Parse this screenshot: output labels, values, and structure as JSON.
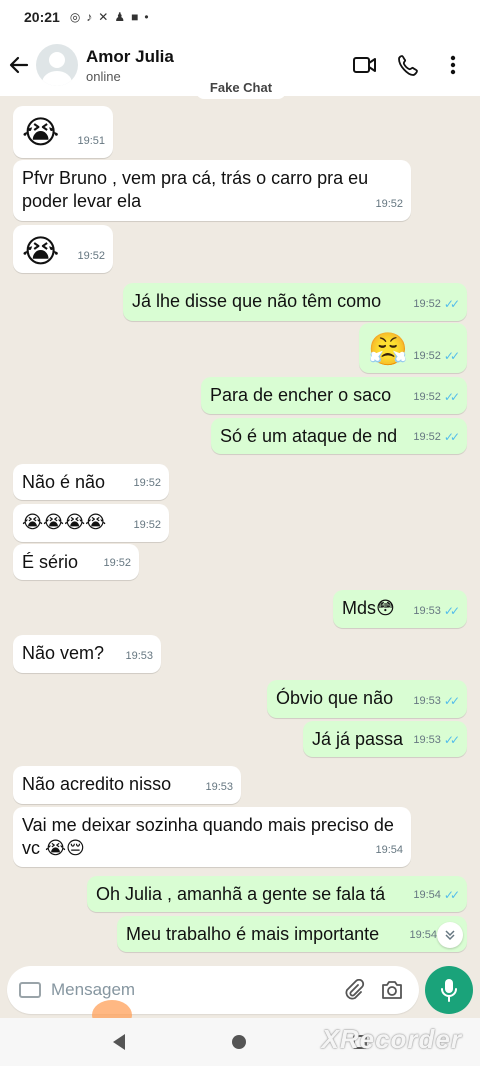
{
  "status_bar": {
    "time": "20:21",
    "icons": [
      "whatsapp-icon",
      "tiktok-icon",
      "capcut-icon",
      "notification-icon",
      "video-icon",
      "dot"
    ]
  },
  "header": {
    "name": "Amor Julia",
    "status": "online"
  },
  "watermark_top": "Fake Chat",
  "messages": [
    {
      "dir": "in",
      "text": "😭",
      "time": "19:51",
      "kind": "emoji"
    },
    {
      "dir": "in",
      "text": "Pfvr Bruno , vem pra cá, trás o carro pra eu poder levar ela",
      "time": "19:52"
    },
    {
      "dir": "in",
      "text": "😭",
      "time": "19:52",
      "kind": "emoji"
    },
    {
      "dir": "out",
      "text": "Já lhe disse que não têm como",
      "time": "19:52"
    },
    {
      "dir": "out",
      "text": "😤",
      "time": "19:52",
      "kind": "emoji"
    },
    {
      "dir": "out",
      "text": "Para de encher o saco",
      "time": "19:52"
    },
    {
      "dir": "out",
      "text": "Só é um ataque de nd",
      "time": "19:52"
    },
    {
      "dir": "in",
      "text": "Não é não",
      "time": "19:52"
    },
    {
      "dir": "in",
      "text": "😭😭😭😭",
      "time": "19:52"
    },
    {
      "dir": "in",
      "text": "É sério",
      "time": "19:52"
    },
    {
      "dir": "out",
      "text": "Mds😳",
      "time": "19:53"
    },
    {
      "dir": "in",
      "text": "Não vem?",
      "time": "19:53"
    },
    {
      "dir": "out",
      "text": "Óbvio que não",
      "time": "19:53"
    },
    {
      "dir": "out",
      "text": "Já já passa",
      "time": "19:53"
    },
    {
      "dir": "in",
      "text": "Não acredito nisso",
      "time": "19:53"
    },
    {
      "dir": "in",
      "text": "Vai me deixar sozinha quando mais preciso de vc 😭😔",
      "time": "19:54"
    },
    {
      "dir": "out",
      "text": "Oh Julia , amanhã a gente se fala tá",
      "time": "19:54"
    },
    {
      "dir": "out",
      "text": "Meu trabalho é mais importante",
      "time": "19:54"
    }
  ],
  "input": {
    "placeholder": "Mensagem"
  },
  "colors": {
    "incoming": "#ffffff",
    "outgoing": "#d9fdd3",
    "accent": "#1aa37a",
    "read_ticks": "#53bdeb"
  },
  "watermark_bottom": "XRecorder"
}
